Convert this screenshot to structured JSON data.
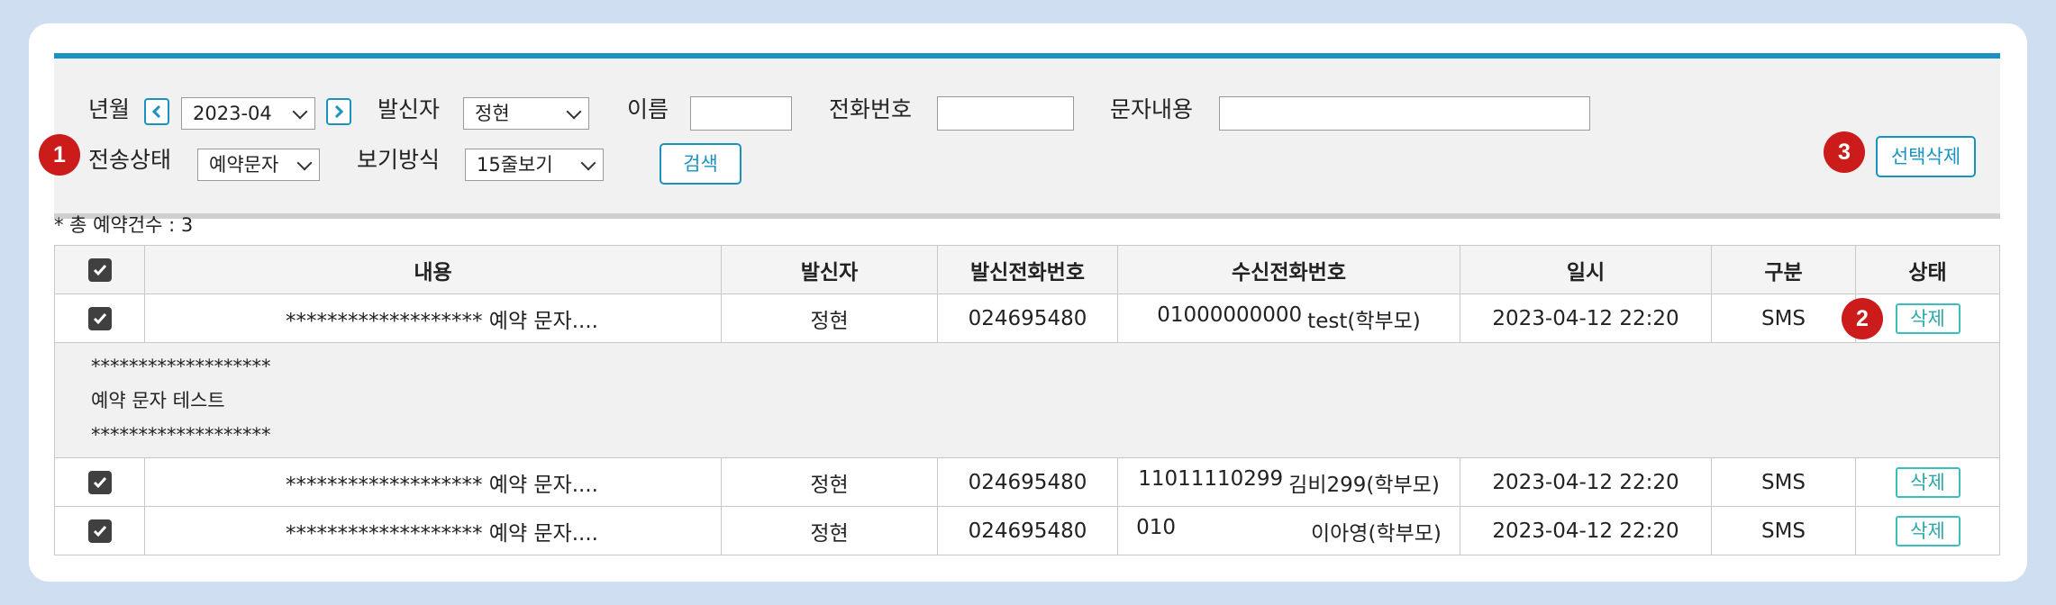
{
  "filters": {
    "month_label": "년월",
    "month_value": "2023-04",
    "sender_label": "발신자",
    "sender_value": "정현",
    "name_label": "이름",
    "name_value": "",
    "phone_label": "전화번호",
    "phone_value": "",
    "content_label": "문자내용",
    "content_value": "",
    "status_label": "전송상태",
    "status_value": "예약문자",
    "view_label": "보기방식",
    "view_value": "15줄보기",
    "search_button": "검색",
    "delete_selected_button": "선택삭제"
  },
  "badges": {
    "one": "1",
    "two": "2",
    "three": "3"
  },
  "summary": "* 총 예약건수 : 3",
  "table": {
    "headers": [
      "내용",
      "발신자",
      "발신전화번호",
      "수신전화번호",
      "일시",
      "구분",
      "상태"
    ],
    "rows": [
      {
        "content": "******************* 예약 문자....",
        "sender": "정현",
        "sender_phone": "024695480",
        "recv_phone": "01000000000",
        "recv_name": "test(학부모)",
        "datetime": "2023-04-12 22:20",
        "type": "SMS",
        "status": "삭제"
      },
      {
        "content": "******************* 예약 문자....",
        "sender": "정현",
        "sender_phone": "024695480",
        "recv_phone": "11011110299",
        "recv_name": "김비299(학부모)",
        "datetime": "2023-04-12 22:20",
        "type": "SMS",
        "status": "삭제"
      },
      {
        "content": "******************* 예약 문자....",
        "sender": "정현",
        "sender_phone": "024695480",
        "recv_phone": "010",
        "recv_name": "이아영(학부모)",
        "datetime": "2023-04-12 22:20",
        "type": "SMS",
        "status": "삭제"
      }
    ],
    "detail_lines": [
      "*******************",
      "예약 문자 테스트",
      "*******************"
    ]
  },
  "colors": {
    "accent": "#1a93c1",
    "badge": "#cc1b1b",
    "delete": "#3bbfbd",
    "background": "#cfdff1"
  },
  "icons": {
    "prev": "chevron-left-icon",
    "next": "chevron-right-icon",
    "dropdown": "chevron-down-icon",
    "checkbox": "checkbox-checked-icon"
  }
}
